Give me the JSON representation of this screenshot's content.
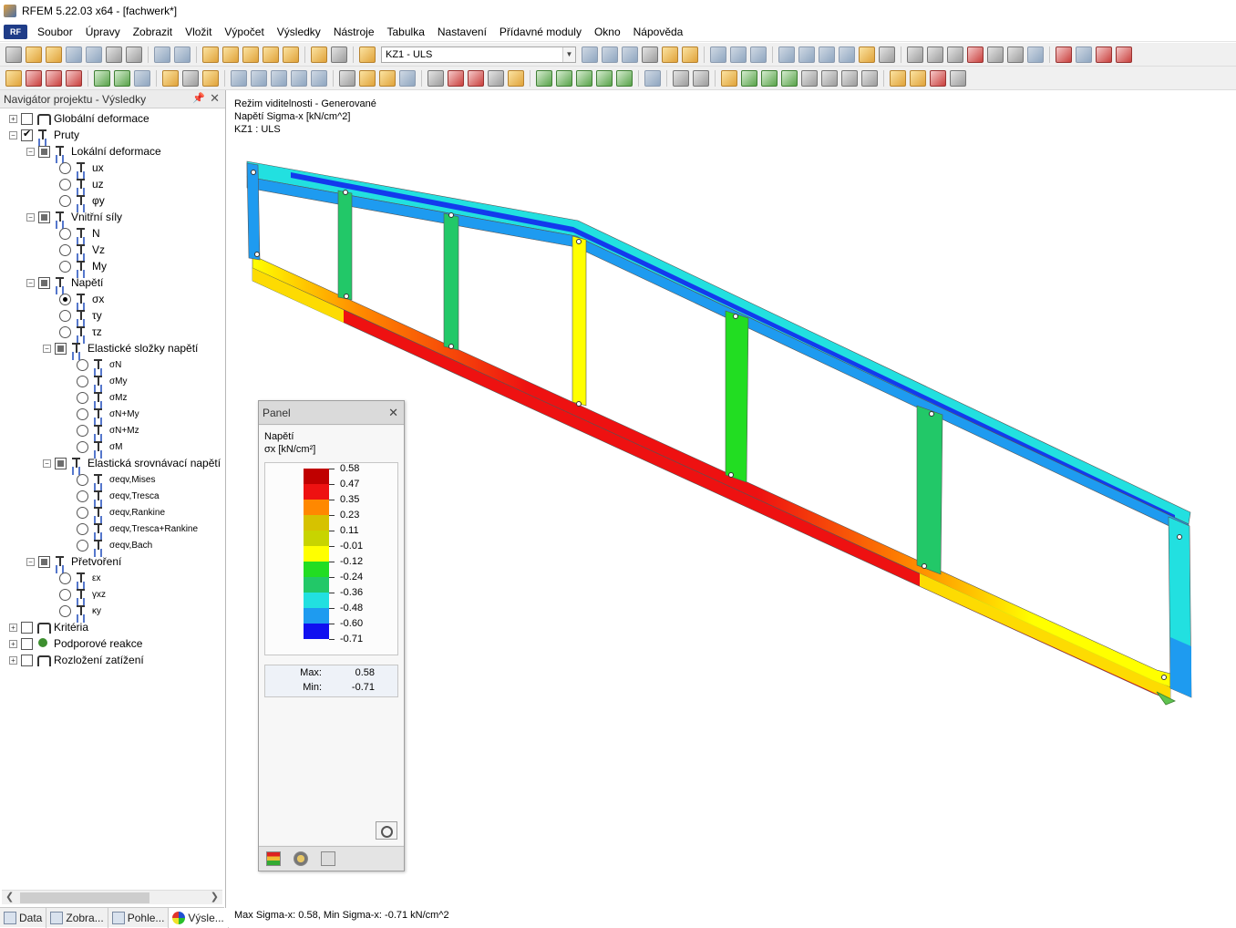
{
  "window": {
    "title": "RFEM 5.22.03 x64 - [fachwerk*]"
  },
  "menu": {
    "items": [
      "Soubor",
      "Úpravy",
      "Zobrazit",
      "Vložit",
      "Výpočet",
      "Výsledky",
      "Nástroje",
      "Tabulka",
      "Nastavení",
      "Přídavné moduly",
      "Okno",
      "Nápověda"
    ]
  },
  "toolbar": {
    "load_case": "KZ1 - ULS"
  },
  "navigator": {
    "title": "Navigátor projektu - Výsledky",
    "nodes": [
      {
        "label": "Globální deformace"
      },
      {
        "label": "Pruty"
      },
      {
        "label": "Lokální deformace"
      },
      {
        "label": "ux"
      },
      {
        "label": "uz"
      },
      {
        "label": "φy"
      },
      {
        "label": "Vnitřní síly"
      },
      {
        "label": "N"
      },
      {
        "label": "Vz"
      },
      {
        "label": "My"
      },
      {
        "label": "Napětí"
      },
      {
        "label": "σx"
      },
      {
        "label": "τy"
      },
      {
        "label": "τz"
      },
      {
        "label": "Elastické složky napětí"
      },
      {
        "label": "σN"
      },
      {
        "label": "σMy"
      },
      {
        "label": "σMz"
      },
      {
        "label": "σN+My"
      },
      {
        "label": "σN+Mz"
      },
      {
        "label": "σM"
      },
      {
        "label": "Elastická srovnávací napětí"
      },
      {
        "label": "σeqv,Mises"
      },
      {
        "label": "σeqv,Tresca"
      },
      {
        "label": "σeqv,Rankine"
      },
      {
        "label": "σeqv,Tresca+Rankine"
      },
      {
        "label": "σeqv,Bach"
      },
      {
        "label": "Přetvoření"
      },
      {
        "label": "εx"
      },
      {
        "label": "γxz"
      },
      {
        "label": "κy"
      },
      {
        "label": "Kritéria"
      },
      {
        "label": "Podporové reakce"
      },
      {
        "label": "Rozložení zatížení"
      }
    ],
    "tabs": [
      "Data",
      "Zobra...",
      "Pohle...",
      "Výsle..."
    ]
  },
  "viewport": {
    "info_lines": [
      "Režim viditelnosti - Generované",
      "Napětí Sigma-x [kN/cm^2]",
      "KZ1 : ULS"
    ],
    "footer": "Max Sigma-x: 0.58, Min Sigma-x: -0.71 kN/cm^2"
  },
  "panel": {
    "title": "Panel",
    "heading": "Napětí",
    "unit": "σx [kN/cm²]",
    "legend": [
      {
        "value": "0.58",
        "color": "#c00000"
      },
      {
        "value": "0.47",
        "color": "#ee1111"
      },
      {
        "value": "0.35",
        "color": "#ff8800"
      },
      {
        "value": "0.23",
        "color": "#d6c200"
      },
      {
        "value": "0.11",
        "color": "#c8d400"
      },
      {
        "value": "-0.01",
        "color": "#ffff00"
      },
      {
        "value": "-0.12",
        "color": "#22dd22"
      },
      {
        "value": "-0.24",
        "color": "#22c868"
      },
      {
        "value": "-0.36",
        "color": "#22e0e0"
      },
      {
        "value": "-0.48",
        "color": "#1e9bf0"
      },
      {
        "value": "-0.60",
        "color": "#1010f0"
      },
      {
        "value": "-0.71",
        "color": "#0a0ab0"
      }
    ],
    "max_label": "Max:",
    "max_value": "0.58",
    "min_label": "Min:",
    "min_value": "-0.71"
  }
}
